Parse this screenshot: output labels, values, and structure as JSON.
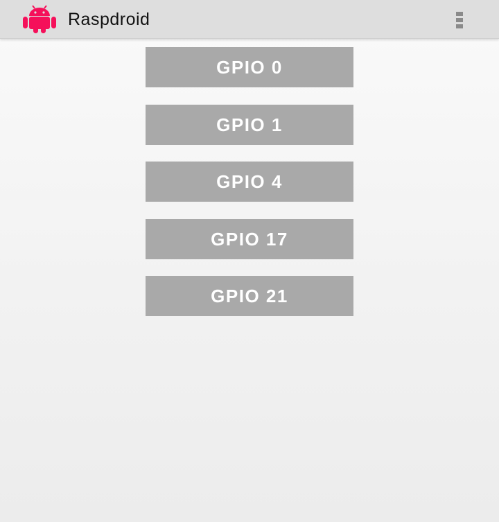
{
  "action_bar": {
    "app_icon": "android-robot-icon",
    "title": "Raspdroid",
    "overflow_icon": "overflow-menu-icon"
  },
  "colors": {
    "action_bar_bg": "#dedede",
    "app_icon": "#f5105a",
    "button_bg": "#a9a9a9",
    "button_text": "#ffffff"
  },
  "gpio_buttons": [
    {
      "label": "GPIO 0"
    },
    {
      "label": "GPIO 1"
    },
    {
      "label": "GPIO 4"
    },
    {
      "label": "GPIO 17"
    },
    {
      "label": "GPIO 21"
    }
  ]
}
